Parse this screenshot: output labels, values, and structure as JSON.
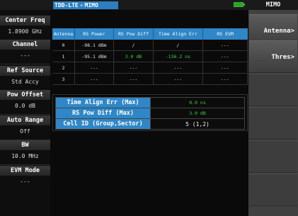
{
  "header": {
    "tech": "TDD-LTE",
    "separator": "+",
    "mode": "MIMO",
    "battery_color": "#22aa22"
  },
  "left_params": [
    {
      "label": "Center Freq",
      "value": "1.8900 GHz"
    },
    {
      "label": "Channel",
      "value": "---"
    },
    {
      "label": "Ref Source",
      "value": "Std Accy"
    },
    {
      "label": "Pow Offset",
      "value": "0.0 dB"
    },
    {
      "label": "Auto Range",
      "value": "Off"
    },
    {
      "label": "BW",
      "value": "10.0 MHz"
    },
    {
      "label": "EVM Mode",
      "value": "---"
    }
  ],
  "softkeys": {
    "title": "MIMO",
    "keys": [
      "Antenna>",
      "Thres>"
    ]
  },
  "table": {
    "columns": [
      "Antenna",
      "RS Power",
      "RS Pow Diff",
      "Time Align Err",
      "RS EVM"
    ],
    "rows": [
      [
        "0",
        "-98.1  dBm",
        "/",
        "/",
        "---"
      ],
      [
        "1",
        "-95.1  dBm",
        "3.0  dB",
        "-136.2  ns",
        "---"
      ],
      [
        "2",
        "---",
        "---",
        "---",
        "---"
      ],
      [
        "3",
        "---",
        "---",
        "---",
        "---"
      ]
    ]
  },
  "summary": [
    {
      "label": "Time Align Err (Max)",
      "value": "0.0 ns"
    },
    {
      "label": "RS Pow Diff (Max)",
      "value": "3.0 dB"
    },
    {
      "label": "Cell ID (Group,Sector)",
      "value": "5 (1,2)"
    }
  ],
  "colors": {
    "accent": "#2f87c7",
    "measure_green": "#3bd13b"
  }
}
